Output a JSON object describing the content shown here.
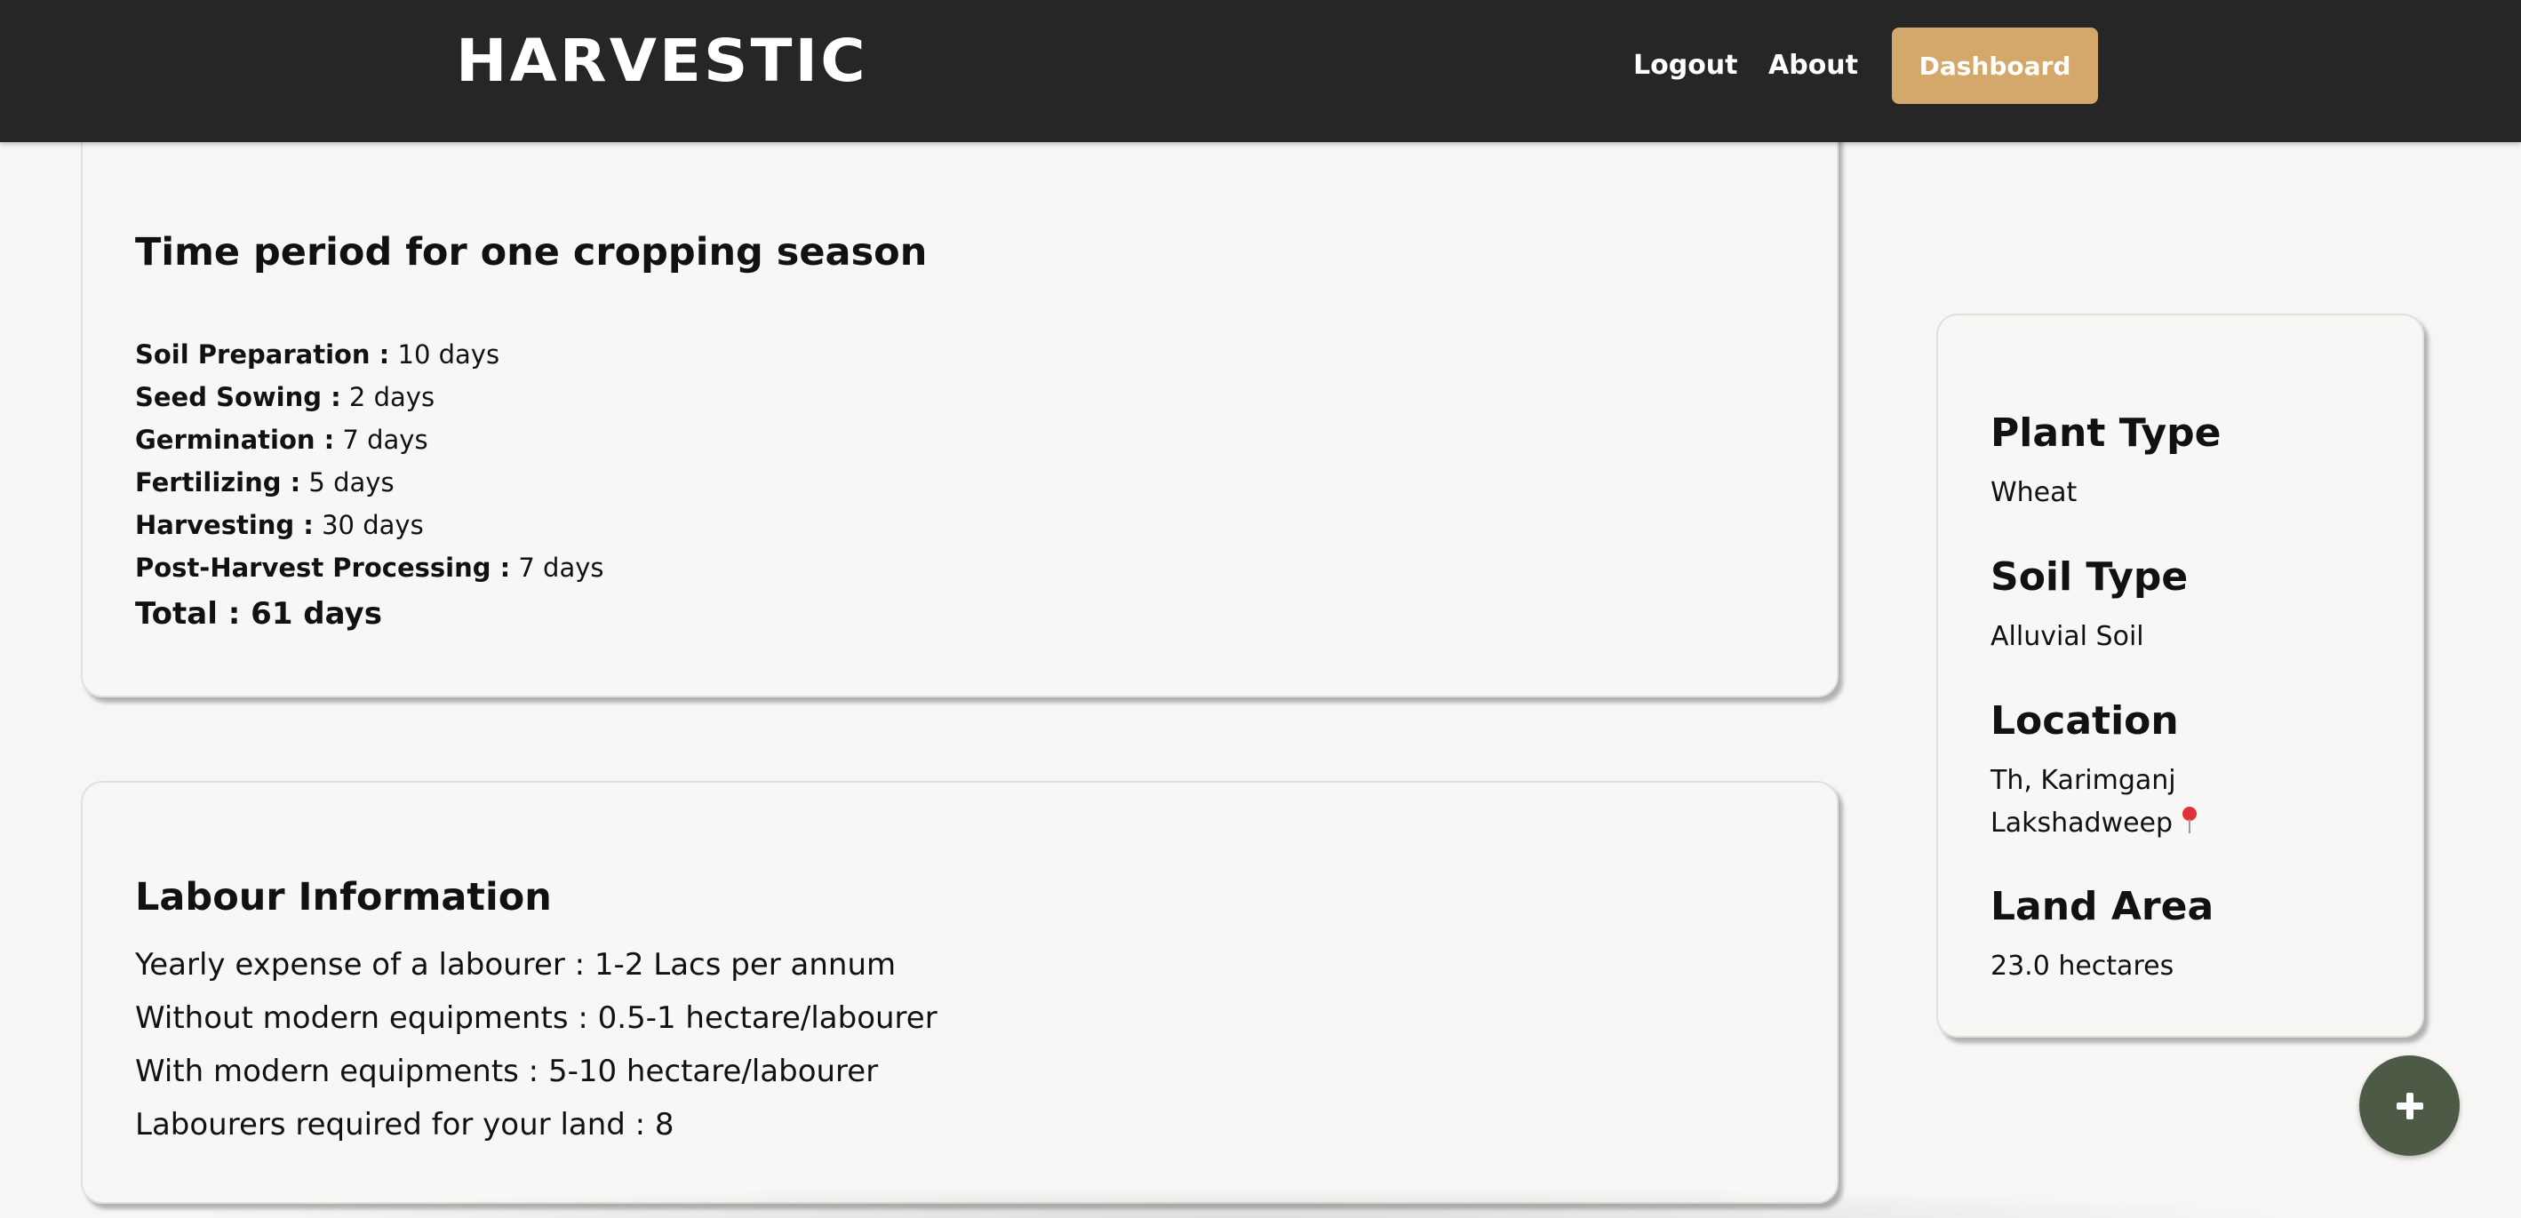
{
  "navbar": {
    "brand": "HARVESTIC",
    "links": {
      "logout": "Logout",
      "about": "About"
    },
    "dashboard_button": "Dashboard"
  },
  "season": {
    "title": "Time period for one cropping season",
    "stages": [
      {
        "label": "Soil Preparation :",
        "value": " 10 days"
      },
      {
        "label": "Seed Sowing :",
        "value": " 2 days"
      },
      {
        "label": "Germination :",
        "value": " 7 days"
      },
      {
        "label": "Fertilizing :",
        "value": " 5 days"
      },
      {
        "label": "Harvesting :",
        "value": " 30 days"
      },
      {
        "label": "Post-Harvest Processing :",
        "value": " 7 days"
      }
    ],
    "total": "Total : 61 days"
  },
  "labour": {
    "title": "Labour Information",
    "rows": [
      "Yearly expense of a labourer : 1-2 Lacs per annum",
      "Without modern equipments : 0.5-1 hectare/labourer",
      "With modern equipments : 5-10 hectare/labourer",
      "Labourers required for your land : 8"
    ]
  },
  "summary": {
    "plant_type": {
      "heading": "Plant Type",
      "value": "Wheat"
    },
    "soil_type": {
      "heading": "Soil Type",
      "value": "Alluvial Soil"
    },
    "location": {
      "heading": "Location",
      "line1": "Th, Karimganj",
      "line2": "Lakshadweep"
    },
    "land_area": {
      "heading": "Land Area",
      "value": "23.0 hectares"
    }
  },
  "fab": {
    "icon": "plus-icon"
  },
  "colors": {
    "navbar": "#262626",
    "accent": "#d4a76a",
    "fab": "#4d5a45",
    "background": "#f7f6f4"
  }
}
